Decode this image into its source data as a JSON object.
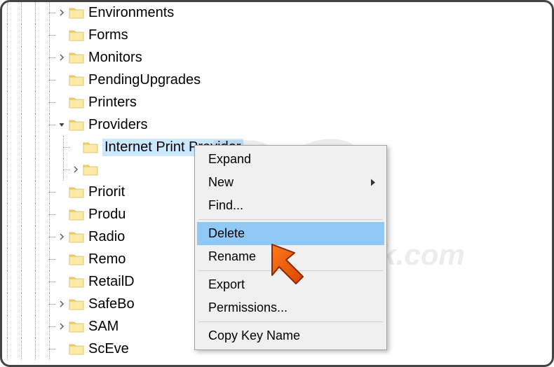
{
  "tree": {
    "items": [
      {
        "label": "Environments",
        "depth": 4,
        "expander": "collapsed"
      },
      {
        "label": "Forms",
        "depth": 4,
        "expander": "none"
      },
      {
        "label": "Monitors",
        "depth": 4,
        "expander": "collapsed"
      },
      {
        "label": "PendingUpgrades",
        "depth": 4,
        "expander": "none"
      },
      {
        "label": "Printers",
        "depth": 4,
        "expander": "none"
      },
      {
        "label": "Providers",
        "depth": 4,
        "expander": "expanded"
      },
      {
        "label": "Internet Print Provider",
        "depth": 5,
        "expander": "none",
        "selected": true
      },
      {
        "label": "",
        "depth": 5,
        "expander": "collapsed"
      },
      {
        "label": "Priorit",
        "depth": 4,
        "expander": "none",
        "truncated": true
      },
      {
        "label": "Produ",
        "depth": 4,
        "expander": "none",
        "truncated": true
      },
      {
        "label": "Radio",
        "depth": 4,
        "expander": "collapsed",
        "truncated": true
      },
      {
        "label": "Remo",
        "depth": 4,
        "expander": "none",
        "truncated": true
      },
      {
        "label": "RetailD",
        "depth": 4,
        "expander": "none",
        "truncated": true
      },
      {
        "label": "SafeBo",
        "depth": 4,
        "expander": "collapsed",
        "truncated": true
      },
      {
        "label": "SAM",
        "depth": 4,
        "expander": "collapsed"
      },
      {
        "label": "ScEve",
        "depth": 4,
        "expander": "none",
        "truncated": true
      }
    ]
  },
  "context_menu": {
    "items": [
      {
        "label": "Expand",
        "type": "item"
      },
      {
        "label": "New",
        "type": "submenu"
      },
      {
        "label": "Find...",
        "type": "item"
      },
      {
        "type": "divider"
      },
      {
        "label": "Delete",
        "type": "item",
        "highlighted": true
      },
      {
        "label": "Rename",
        "type": "item"
      },
      {
        "type": "divider"
      },
      {
        "label": "Export",
        "type": "item"
      },
      {
        "label": "Permissions...",
        "type": "item"
      },
      {
        "type": "divider"
      },
      {
        "label": "Copy Key Name",
        "type": "item"
      }
    ]
  },
  "watermark": {
    "main": "PC",
    "sub": "risk.com"
  }
}
